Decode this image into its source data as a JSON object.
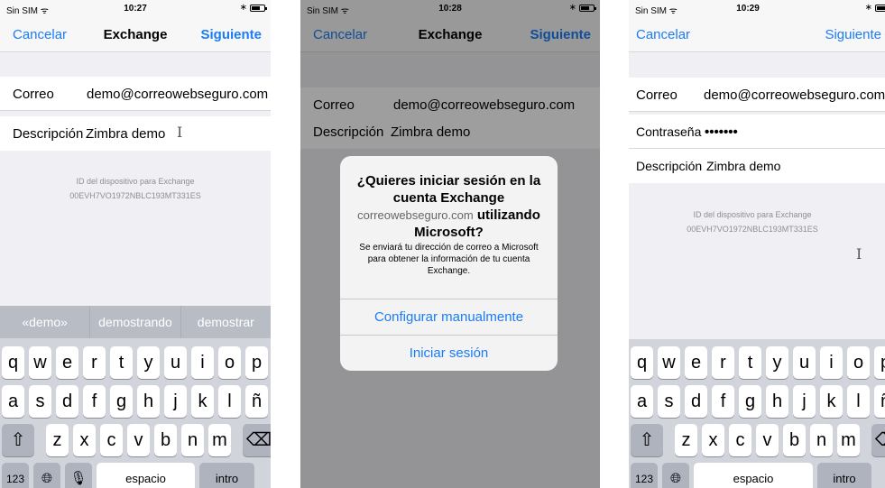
{
  "screens": [
    {
      "status": {
        "carrier": "Sin SIM ᯤ",
        "time": "10:27",
        "bluetooth": "∗"
      },
      "nav": {
        "cancel": "Cancelar",
        "title": "Exchange",
        "next": "Siguiente"
      },
      "fields": {
        "email_label": "Correo",
        "email_value": "demo@correowebseguro.com",
        "desc_label": "Descripción",
        "desc_value": "Zimbra demo"
      },
      "device": {
        "label": "ID del dispositivo para Exchange",
        "id": "00EVH7VO1972NBLC193MT331ES"
      },
      "suggestions": [
        "«demo»",
        "demostrando",
        "demostrar"
      ],
      "keys": {
        "row1": [
          "q",
          "w",
          "e",
          "r",
          "t",
          "y",
          "u",
          "i",
          "o",
          "p"
        ],
        "row2": [
          "a",
          "s",
          "d",
          "f",
          "g",
          "h",
          "j",
          "k",
          "l",
          "ñ"
        ],
        "row3": [
          "z",
          "x",
          "c",
          "v",
          "b",
          "n",
          "m"
        ],
        "shift": "⇧",
        "backspace": "⌫",
        "numbers": "123",
        "globe": "🌐︎",
        "mic": "🎙︎",
        "space": "espacio",
        "return": "intro"
      }
    },
    {
      "status": {
        "carrier": "Sin SIM ᯤ",
        "time": "10:28",
        "bluetooth": "∗"
      },
      "nav": {
        "cancel": "Cancelar",
        "title": "Exchange",
        "next": "Siguiente"
      },
      "fields": {
        "email_label": "Correo",
        "email_value": "demo@correowebseguro.com",
        "desc_label": "Descripción",
        "desc_value": "Zimbra demo"
      },
      "alert": {
        "title_line1": "¿Quieres iniciar sesión en la",
        "title_line2": "cuenta Exchange",
        "domain": "correowebseguro.com",
        "title_line3": " utilizando",
        "title_line4": "Microsoft?",
        "message": "Se enviará tu dirección de correo a Microsoft para obtener la información de tu cuenta Exchange.",
        "button_manual": "Configurar manualmente",
        "button_signin": "Iniciar sesión"
      }
    },
    {
      "status": {
        "carrier": "Sin SIM ᯤ",
        "time": "10:29",
        "bluetooth": "∗"
      },
      "nav": {
        "cancel": "Cancelar",
        "next": "Siguiente"
      },
      "fields": {
        "email_label": "Correo",
        "email_value": "demo@correowebseguro.com",
        "password_label": "Contraseña",
        "password_value": "•••••••",
        "desc_label": "Descripción",
        "desc_value": "Zimbra demo"
      },
      "device": {
        "label": "ID del dispositivo para Exchange",
        "id": "00EVH7VO1972NBLC193MT331ES"
      },
      "keys": {
        "row1": [
          "q",
          "w",
          "e",
          "r",
          "t",
          "y",
          "u",
          "i",
          "o",
          "p"
        ],
        "row2": [
          "a",
          "s",
          "d",
          "f",
          "g",
          "h",
          "j",
          "k",
          "l",
          "ñ"
        ],
        "row3": [
          "z",
          "x",
          "c",
          "v",
          "b",
          "n",
          "m"
        ],
        "shift": "⇧",
        "backspace": "⌫",
        "numbers": "123",
        "globe": "🌐︎",
        "space": "espacio",
        "return": "intro"
      }
    }
  ]
}
